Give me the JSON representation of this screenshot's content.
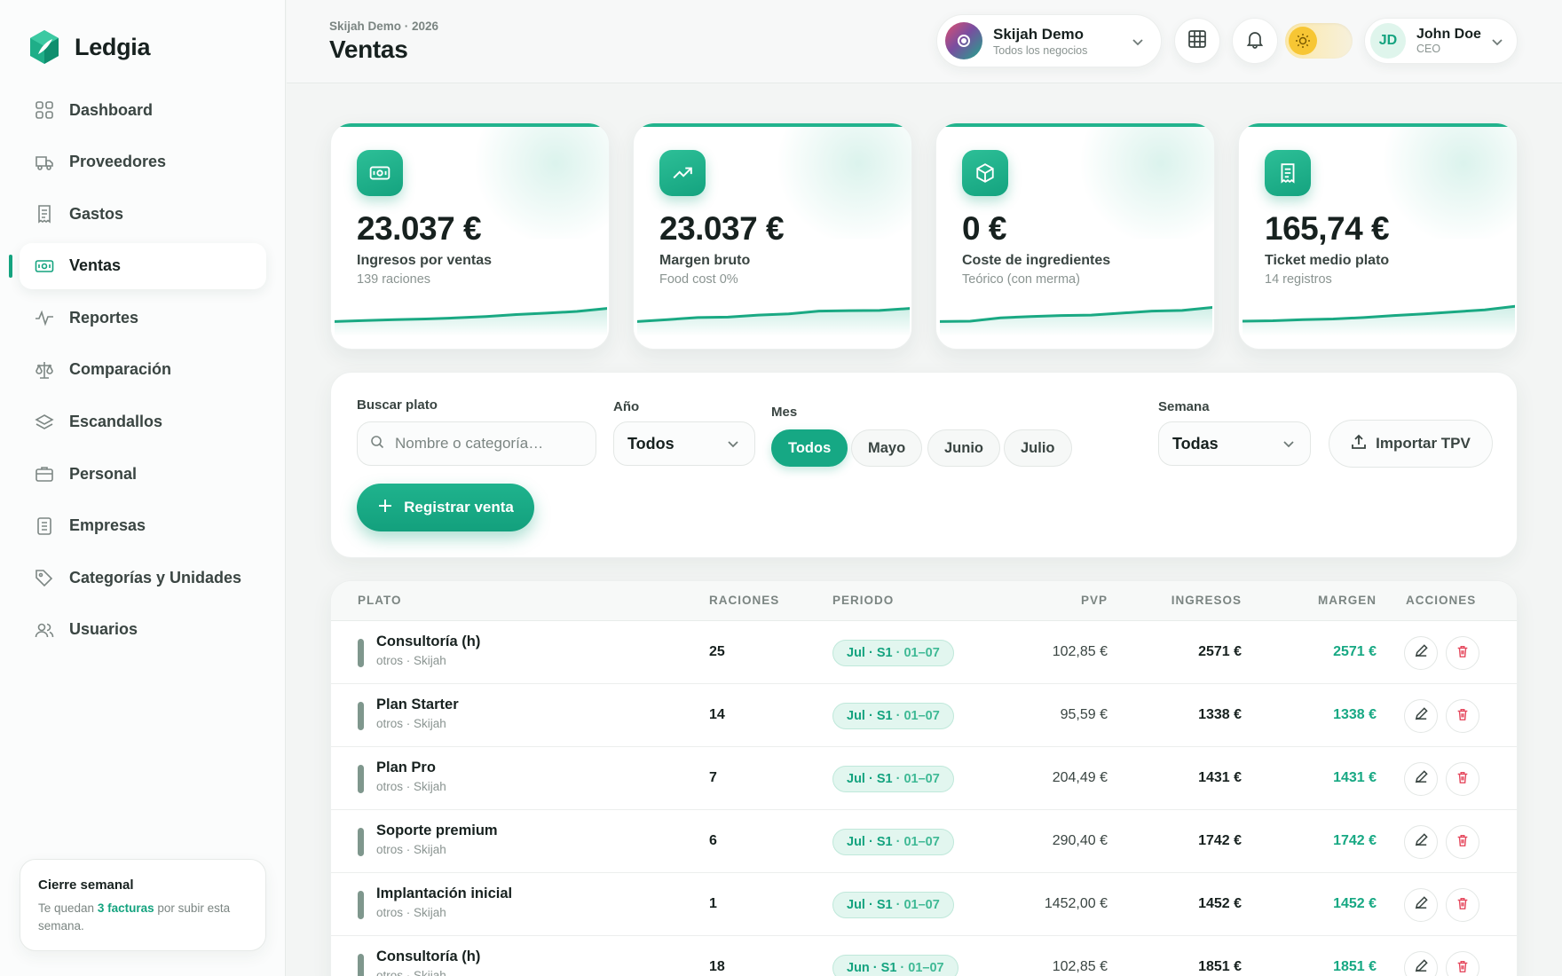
{
  "app": {
    "name": "Ledgia"
  },
  "sidebar": {
    "items": [
      {
        "label": "Dashboard",
        "icon": "grid-icon",
        "active": false
      },
      {
        "label": "Proveedores",
        "icon": "truck-icon",
        "active": false
      },
      {
        "label": "Gastos",
        "icon": "receipt-icon",
        "active": false
      },
      {
        "label": "Ventas",
        "icon": "cash-icon",
        "active": true
      },
      {
        "label": "Reportes",
        "icon": "pulse-icon",
        "active": false
      },
      {
        "label": "Comparación",
        "icon": "scale-icon",
        "active": false
      },
      {
        "label": "Escandallos",
        "icon": "layers-icon",
        "active": false
      },
      {
        "label": "Personal",
        "icon": "briefcase-icon",
        "active": false
      },
      {
        "label": "Empresas",
        "icon": "document-icon",
        "active": false
      },
      {
        "label": "Categorías y Unidades",
        "icon": "tag-icon",
        "active": false
      },
      {
        "label": "Usuarios",
        "icon": "users-icon",
        "active": false
      }
    ],
    "promo": {
      "title": "Cierre semanal",
      "text_before": "Te quedan ",
      "highlight": "3 facturas",
      "text_after": " por subir esta semana."
    }
  },
  "header": {
    "crumb": "Skijah Demo · 2026",
    "title": "Ventas",
    "org": {
      "name": "Skijah Demo",
      "sub": "Todos los negocios"
    },
    "user": {
      "initials": "JD",
      "name": "John Doe",
      "role": "CEO"
    }
  },
  "kpis": [
    {
      "icon": "cash-icon",
      "value": "23.037 €",
      "label": "Ingresos por ventas",
      "sub": "139 raciones",
      "trend": [
        0.2,
        0.25,
        0.3,
        0.33,
        0.38,
        0.45,
        0.55,
        0.62,
        0.7,
        0.85
      ]
    },
    {
      "icon": "trend-up-icon",
      "value": "23.037 €",
      "label": "Margen bruto",
      "sub": "Food cost 0%",
      "trend": [
        0.2,
        0.3,
        0.4,
        0.42,
        0.52,
        0.58,
        0.72,
        0.74,
        0.75,
        0.85
      ]
    },
    {
      "icon": "box-icon",
      "value": "0 €",
      "label": "Coste de ingredientes",
      "sub": "Teórico (con merma)",
      "trend": [
        0.2,
        0.22,
        0.38,
        0.45,
        0.5,
        0.52,
        0.62,
        0.72,
        0.75,
        0.9
      ]
    },
    {
      "icon": "receipt-icon",
      "value": "165,74 €",
      "label": "Ticket medio plato",
      "sub": "14 registros",
      "trend": [
        0.22,
        0.24,
        0.3,
        0.33,
        0.4,
        0.5,
        0.58,
        0.68,
        0.78,
        0.95
      ]
    }
  ],
  "filters": {
    "search": {
      "label": "Buscar plato",
      "placeholder": "Nombre o categoría…"
    },
    "year": {
      "label": "Año",
      "value": "Todos"
    },
    "month": {
      "label": "Mes",
      "options": [
        "Todos",
        "Mayo",
        "Junio",
        "Julio"
      ],
      "selected": "Todos"
    },
    "week": {
      "label": "Semana",
      "value": "Todas"
    },
    "import_label": "Importar TPV",
    "register_label": "Registrar venta"
  },
  "table": {
    "headers": {
      "plato": "PLATO",
      "raciones": "RACIONES",
      "periodo": "PERIODO",
      "pvp": "PVP",
      "ingresos": "INGRESOS",
      "margen": "MARGEN",
      "acciones": "ACCIONES"
    },
    "rows": [
      {
        "name": "Consultoría (h)",
        "meta": "otros · Skijah",
        "raciones": "25",
        "period_main": "Jul · S1",
        "period_range": " · 01–07",
        "pvp": "102,85 €",
        "ingresos": "2571 €",
        "margen": "2571 €"
      },
      {
        "name": "Plan Starter",
        "meta": "otros · Skijah",
        "raciones": "14",
        "period_main": "Jul · S1",
        "period_range": " · 01–07",
        "pvp": "95,59 €",
        "ingresos": "1338 €",
        "margen": "1338 €"
      },
      {
        "name": "Plan Pro",
        "meta": "otros · Skijah",
        "raciones": "7",
        "period_main": "Jul · S1",
        "period_range": " · 01–07",
        "pvp": "204,49 €",
        "ingresos": "1431 €",
        "margen": "1431 €"
      },
      {
        "name": "Soporte premium",
        "meta": "otros · Skijah",
        "raciones": "6",
        "period_main": "Jul · S1",
        "period_range": " · 01–07",
        "pvp": "290,40 €",
        "ingresos": "1742 €",
        "margen": "1742 €"
      },
      {
        "name": "Implantación inicial",
        "meta": "otros · Skijah",
        "raciones": "1",
        "period_main": "Jul · S1",
        "period_range": " · 01–07",
        "pvp": "1452,00 €",
        "ingresos": "1452 €",
        "margen": "1452 €"
      },
      {
        "name": "Consultoría (h)",
        "meta": "otros · Skijah",
        "raciones": "18",
        "period_main": "Jun · S1",
        "period_range": " · 01–07",
        "pvp": "102,85 €",
        "ingresos": "1851 €",
        "margen": "1851 €"
      }
    ]
  },
  "colors": {
    "accent": "#14a37f",
    "danger": "#e5485d",
    "text": "#17211f"
  }
}
